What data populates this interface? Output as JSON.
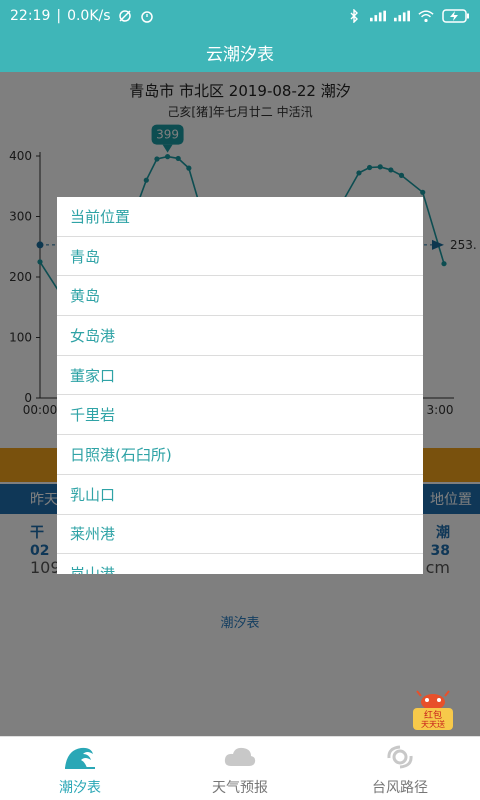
{
  "status_bar": {
    "time": "22:19",
    "speed": "0.0K/s",
    "battery_icon": "battery-charging-icon"
  },
  "app_title": "云潮汐表",
  "chart_header": {
    "title": "青岛市 市北区 2019-08-22 潮汐",
    "subtitle": "己亥[猪]年七月廿二 中活汛"
  },
  "chart_data": {
    "type": "line",
    "ylim": [
      0,
      400
    ],
    "y_ticks": [
      "0",
      "100",
      "200",
      "300",
      "400"
    ],
    "x_tick_labels": [
      "00:00",
      "3:00"
    ],
    "peak_label": "399",
    "current_label": "253.",
    "series": [
      {
        "values": [
          [
            0,
            225
          ],
          [
            1,
            170
          ],
          [
            3,
            210
          ],
          [
            4,
            265
          ],
          [
            5,
            360
          ],
          [
            5.5,
            395
          ],
          [
            6,
            399
          ],
          [
            6.5,
            396
          ],
          [
            7,
            380
          ],
          [
            8,
            260
          ],
          [
            9,
            160
          ],
          [
            13,
            200
          ],
          [
            14,
            310
          ],
          [
            15,
            372
          ],
          [
            15.5,
            381
          ],
          [
            16,
            382
          ],
          [
            16.5,
            377
          ],
          [
            17,
            368
          ],
          [
            18,
            340
          ],
          [
            19,
            222
          ]
        ]
      }
    ],
    "colors": {
      "line": "#1a9aa3",
      "axis": "#333333"
    }
  },
  "buttons": {
    "left_partial": "昨天",
    "right_partial": "地位置"
  },
  "info": {
    "left_title": "干",
    "left_time": "02",
    "left_value": "109",
    "right_title": "潮",
    "right_time": "38",
    "right_value": "cm"
  },
  "tide_link": "潮汐表",
  "dialog": {
    "items": [
      "当前位置",
      "青岛",
      "黄岛",
      "女岛港",
      "董家口",
      "千里岩",
      "日照港(石臼所)",
      "乳山口",
      "莱州港",
      "岚山港"
    ]
  },
  "red_packet": {
    "line1": "红包",
    "line2": "天天送"
  },
  "bottom_nav": {
    "items": [
      {
        "label": "潮汐表",
        "icon": "wave-icon"
      },
      {
        "label": "天气预报",
        "icon": "cloud-icon"
      },
      {
        "label": "台风路径",
        "icon": "typhoon-icon"
      }
    ]
  }
}
